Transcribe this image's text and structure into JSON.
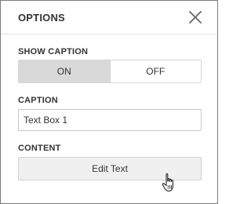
{
  "header": {
    "title": "OPTIONS",
    "close_icon": "close-icon"
  },
  "show_caption": {
    "label": "SHOW CAPTION",
    "options": [
      "ON",
      "OFF"
    ],
    "selected": "ON"
  },
  "caption": {
    "label": "CAPTION",
    "value": "Text Box 1"
  },
  "content": {
    "label": "CONTENT",
    "button_label": "Edit Text"
  },
  "cursor": "hand-pointer-icon"
}
